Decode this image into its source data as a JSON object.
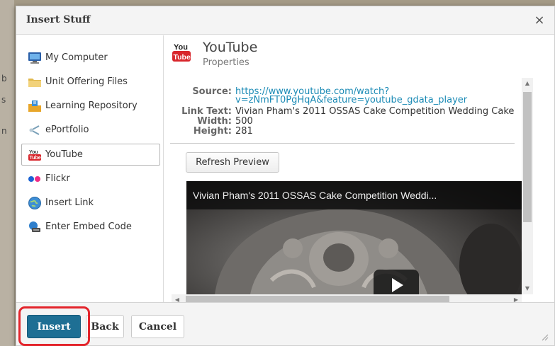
{
  "dialog": {
    "title": "Insert Stuff",
    "close_label": "×"
  },
  "sidebar": {
    "items": [
      {
        "label": "My Computer",
        "icon": "computer-icon"
      },
      {
        "label": "Unit Offering Files",
        "icon": "folder-icon"
      },
      {
        "label": "Learning Repository",
        "icon": "repository-icon"
      },
      {
        "label": "ePortfolio",
        "icon": "eportfolio-icon"
      },
      {
        "label": "YouTube",
        "icon": "youtube-icon",
        "selected": true
      },
      {
        "label": "Flickr",
        "icon": "flickr-icon"
      },
      {
        "label": "Insert Link",
        "icon": "globe-link-icon"
      },
      {
        "label": "Enter Embed Code",
        "icon": "embed-code-icon"
      }
    ]
  },
  "panel": {
    "title": "YouTube",
    "subtitle": "Properties",
    "properties": {
      "source_key": "Source:",
      "source_line1": "https://www.youtube.com/watch?",
      "source_line2": "v=zNmFT0PgHqA&feature=youtube_gdata_player",
      "link_text_key": "Link Text:",
      "link_text": "Vivian Pham's 2011 OSSAS Cake Competition Wedding Cake",
      "width_key": "Width:",
      "width": "500",
      "height_key": "Height:",
      "height": "281"
    },
    "refresh_label": "Refresh Preview",
    "video_title": "Vivian Pham's 2011 OSSAS Cake Competition Weddi..."
  },
  "footer": {
    "insert_label": "Insert",
    "back_label": "Back",
    "cancel_label": "Cancel"
  },
  "colors": {
    "primary": "#1e6f94",
    "highlight": "#e3242b",
    "link": "#1a8ab5"
  }
}
